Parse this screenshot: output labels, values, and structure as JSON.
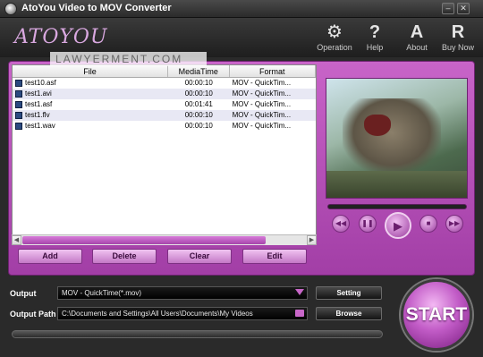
{
  "window": {
    "title": "AtoYou Video to MOV Converter"
  },
  "header": {
    "logo": "ATOYOU",
    "watermark": "LAWYERMENT.COM",
    "tools": [
      {
        "label": "Operation",
        "icon": "gear-icon"
      },
      {
        "label": "Help",
        "icon": "question-icon",
        "glyph": "?"
      },
      {
        "label": "About",
        "icon": "about-icon",
        "glyph": "A"
      },
      {
        "label": "Buy Now",
        "icon": "buy-icon",
        "glyph": "R"
      }
    ]
  },
  "filelist": {
    "columns": [
      "File",
      "MediaTime",
      "Format"
    ],
    "rows": [
      {
        "file": "test10.asf",
        "time": "00:00:10",
        "format": "MOV - QuickTim..."
      },
      {
        "file": "test1.avi",
        "time": "00:00:10",
        "format": "MOV - QuickTim..."
      },
      {
        "file": "test1.asf",
        "time": "00:01:41",
        "format": "MOV - QuickTim..."
      },
      {
        "file": "test1.flv",
        "time": "00:00:10",
        "format": "MOV - QuickTim..."
      },
      {
        "file": "test1.wav",
        "time": "00:00:10",
        "format": "MOV - QuickTim..."
      }
    ]
  },
  "actions": {
    "add": "Add",
    "delete": "Delete",
    "clear": "Clear",
    "edit": "Edit"
  },
  "player": {
    "rewind": "◀◀",
    "pause": "❚❚",
    "play": "▶",
    "stop": "■",
    "forward": "▶▶"
  },
  "settings": {
    "output_label": "Output",
    "output_value": "MOV - QuickTime(*.mov)",
    "path_label": "Output Path",
    "path_value": "C:\\Documents and Settings\\All Users\\Documents\\My Videos",
    "setting_button": "Setting",
    "browse_button": "Browse"
  },
  "start_button": "START",
  "colors": {
    "accent": "#b44cb8",
    "dark": "#2a2a2a"
  }
}
